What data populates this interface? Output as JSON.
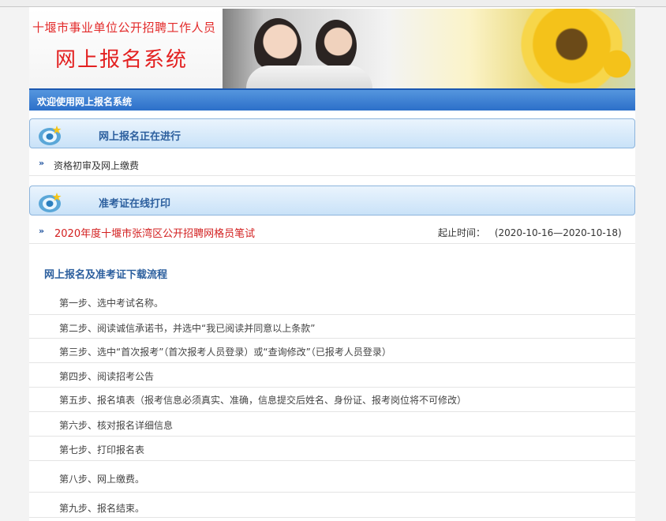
{
  "banner": {
    "subtitle": "十堰市事业单位公开招聘工作人员",
    "title": "网上报名系统"
  },
  "welcome_bar": "欢迎使用网上报名系统",
  "sections": [
    {
      "title": "网上报名正在进行",
      "items": [
        {
          "text": "资格初审及网上缴费"
        }
      ]
    },
    {
      "title": "准考证在线打印",
      "items": [
        {
          "link": "2020年度十堰市张湾区公开招聘网格员笔试",
          "date_label": "起止时间：",
          "date_range": "(2020-10-16—2020-10-18)"
        }
      ]
    }
  ],
  "flow": {
    "title": "网上报名及准考证下载流程",
    "steps": [
      "第一步、选中考试名称。",
      "第二步、阅读诚信承诺书，并选中“我已阅读并同意以上条款”",
      "第三步、选中“首次报考”（首次报考人员登录）或“查询修改”（已报考人员登录）",
      "第四步、阅读招考公告",
      "第五步、报名填表（报考信息必须真实、准确，信息提交后姓名、身份证、报考岗位将不可修改）",
      "第六步、核对报名详细信息",
      "第七步、打印报名表",
      "第八步、网上缴费。",
      "第九步、报名结束。"
    ]
  },
  "colors": {
    "accent_blue": "#2c6fc9",
    "title_red": "#e32020",
    "link_red": "#d32020",
    "section_title_blue": "#2c5f9e"
  },
  "icons": {
    "section_icon": "speaker-star-icon",
    "bullet_icon": "double-chevron-right-icon"
  }
}
